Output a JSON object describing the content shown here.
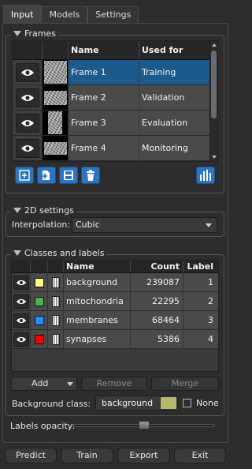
{
  "tabs": [
    {
      "label": "Input",
      "active": true
    },
    {
      "label": "Models",
      "active": false
    },
    {
      "label": "Settings",
      "active": false
    }
  ],
  "frames": {
    "title": "Frames",
    "columns": [
      "Name",
      "Used for"
    ],
    "rows": [
      {
        "name": "Frame 1",
        "used_for": "Training",
        "selected": true
      },
      {
        "name": "Frame 2",
        "used_for": "Validation",
        "selected": false
      },
      {
        "name": "Frame 3",
        "used_for": "Evaluation",
        "selected": false
      },
      {
        "name": "Frame 4",
        "used_for": "Monitoring",
        "selected": false
      }
    ],
    "toolbar_icons": [
      "add-frame-icon",
      "import-frame-icon",
      "save-frame-icon",
      "delete-frame-icon"
    ],
    "stats_icon": "statistics-icon"
  },
  "settings_2d": {
    "title": "2D settings",
    "interpolation_label": "Interpolation:",
    "interpolation_value": "Cubic"
  },
  "classes": {
    "title": "Classes and labels",
    "columns": [
      "Name",
      "Count",
      "Label"
    ],
    "rows": [
      {
        "name": "background",
        "count": "239087",
        "label": "1",
        "color": "#ffff80"
      },
      {
        "name": "mitochondria",
        "count": "22295",
        "label": "2",
        "color": "#4caf50"
      },
      {
        "name": "membranes",
        "count": "68464",
        "label": "3",
        "color": "#1e90ff"
      },
      {
        "name": "synapses",
        "count": "5386",
        "label": "4",
        "color": "#ff0000"
      }
    ],
    "add_label": "Add",
    "remove_label": "Remove",
    "merge_label": "Merge",
    "background_class_label": "Background class:",
    "background_class_value": "background",
    "background_class_color": "#b8b86a",
    "none_label": "None",
    "none_checked": false
  },
  "labels_opacity": {
    "label": "Labels opacity:",
    "value": 0.5
  },
  "actions": {
    "predict": "Predict",
    "train": "Train",
    "export": "Export",
    "exit": "Exit"
  },
  "colors": {
    "selection": "#1c5a8c",
    "accent_button": "#2f74c0",
    "background": "#2d2d2d"
  }
}
